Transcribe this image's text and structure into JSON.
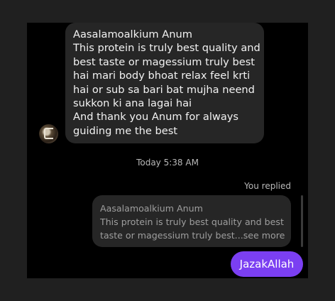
{
  "incoming_message": {
    "lines": [
      "Aasalamoalkium Anum",
      "This protein is truly best quality and",
      "best taste or magessium truly best",
      "hai mari body bhoat relax feel krti",
      "hai or sub sa bari bat mujha neend",
      "sukkon ki ana lagai hai",
      "And thank you Anum  for always",
      "guiding me the best"
    ]
  },
  "timestamp": "Today 5:38 AM",
  "reply_context": {
    "label": "You replied",
    "quoted_lines": [
      "Aasalamoalkium Anum",
      "This protein is truly best quality and best",
      "taste or magessium truly best...see more"
    ]
  },
  "outgoing_message": {
    "text": "JazakAllah",
    "color": "#7b3ff2"
  }
}
